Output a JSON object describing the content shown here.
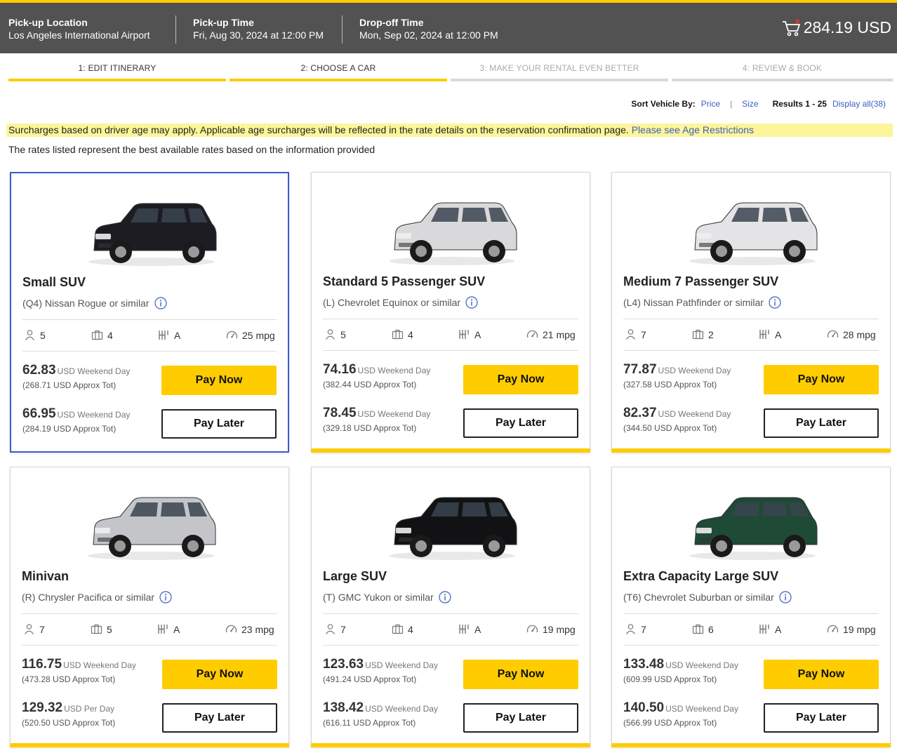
{
  "header": {
    "pickup_location_label": "Pick-up Location",
    "pickup_location": "Los Angeles International Airport",
    "pickup_time_label": "Pick-up Time",
    "pickup_time": "Fri, Aug 30, 2024 at 12:00 PM",
    "dropoff_time_label": "Drop-off Time",
    "dropoff_time": "Mon, Sep 02, 2024 at 12:00 PM",
    "cart_total": "284.19 USD"
  },
  "steps": [
    {
      "label": "1:  EDIT ITINERARY",
      "active": true
    },
    {
      "label": "2:  CHOOSE A CAR",
      "active": true
    },
    {
      "label": "3:  MAKE YOUR RENTAL EVEN BETTER",
      "active": false
    },
    {
      "label": "4:  REVIEW & BOOK",
      "active": false
    }
  ],
  "sort": {
    "label": "Sort Vehicle By:",
    "price": "Price",
    "separator": "|",
    "size": "Size",
    "results": "Results 1 - 25",
    "display_all": "Display all(38)"
  },
  "notice": {
    "text": "Surcharges based on driver age may apply. Applicable age surcharges will be reflected in the rate details on the reservation confirmation page. ",
    "link": "Please see Age Restrictions"
  },
  "rates_note": "The rates listed represent the best available rates based on the information provided",
  "labels": {
    "pay_now": "Pay Now",
    "pay_later": "Pay Later"
  },
  "cars": [
    {
      "category": "Small SUV",
      "model": "(Q4) Nissan Rogue or similar",
      "seats": "5",
      "bags": "4",
      "trans": "A",
      "mpg": "25 mpg",
      "now_price": "62.83",
      "now_unit": "USD Weekend Day",
      "now_total": "(268.71 USD Approx Tot)",
      "later_price": "66.95",
      "later_unit": "USD Weekend Day",
      "later_total": "(284.19 USD Approx Tot)",
      "color": "#1c1c22"
    },
    {
      "category": "Standard 5 Passenger SUV",
      "model": "(L) Chevrolet Equinox or similar",
      "seats": "5",
      "bags": "4",
      "trans": "A",
      "mpg": "21 mpg",
      "now_price": "74.16",
      "now_unit": "USD Weekend Day",
      "now_total": "(382.44 USD Approx Tot)",
      "later_price": "78.45",
      "later_unit": "USD Weekend Day",
      "later_total": "(329.18 USD Approx Tot)",
      "color": "#d9d9dc"
    },
    {
      "category": "Medium 7 Passenger SUV",
      "model": "(L4) Nissan Pathfinder or similar",
      "seats": "7",
      "bags": "2",
      "trans": "A",
      "mpg": "28 mpg",
      "now_price": "77.87",
      "now_unit": "USD Weekend Day",
      "now_total": "(327.58 USD Approx Tot)",
      "later_price": "82.37",
      "later_unit": "USD Weekend Day",
      "later_total": "(344.50 USD Approx Tot)",
      "color": "#e4e4e6"
    },
    {
      "category": "Minivan",
      "model": "(R) Chrysler Pacifica or similar",
      "seats": "7",
      "bags": "5",
      "trans": "A",
      "mpg": "23 mpg",
      "now_price": "116.75",
      "now_unit": "USD Weekend Day",
      "now_total": "(473.28 USD Approx Tot)",
      "later_price": "129.32",
      "later_unit": "USD Per Day",
      "later_total": "(520.50 USD Approx Tot)",
      "color": "#c4c5c9"
    },
    {
      "category": "Large SUV",
      "model": "(T) GMC Yukon or similar",
      "seats": "7",
      "bags": "4",
      "trans": "A",
      "mpg": "19 mpg",
      "now_price": "123.63",
      "now_unit": "USD Weekend Day",
      "now_total": "(491.24 USD Approx Tot)",
      "later_price": "138.42",
      "later_unit": "USD Weekend Day",
      "later_total": "(616.11 USD Approx Tot)",
      "color": "#121214"
    },
    {
      "category": "Extra Capacity Large SUV",
      "model": "(T6) Chevrolet Suburban or similar",
      "seats": "7",
      "bags": "6",
      "trans": "A",
      "mpg": "19 mpg",
      "now_price": "133.48",
      "now_unit": "USD Weekend Day",
      "now_total": "(609.99 USD Approx Tot)",
      "later_price": "140.50",
      "later_unit": "USD Weekend Day",
      "later_total": "(566.99 USD Approx Tot)",
      "color": "#1f4a35"
    }
  ]
}
